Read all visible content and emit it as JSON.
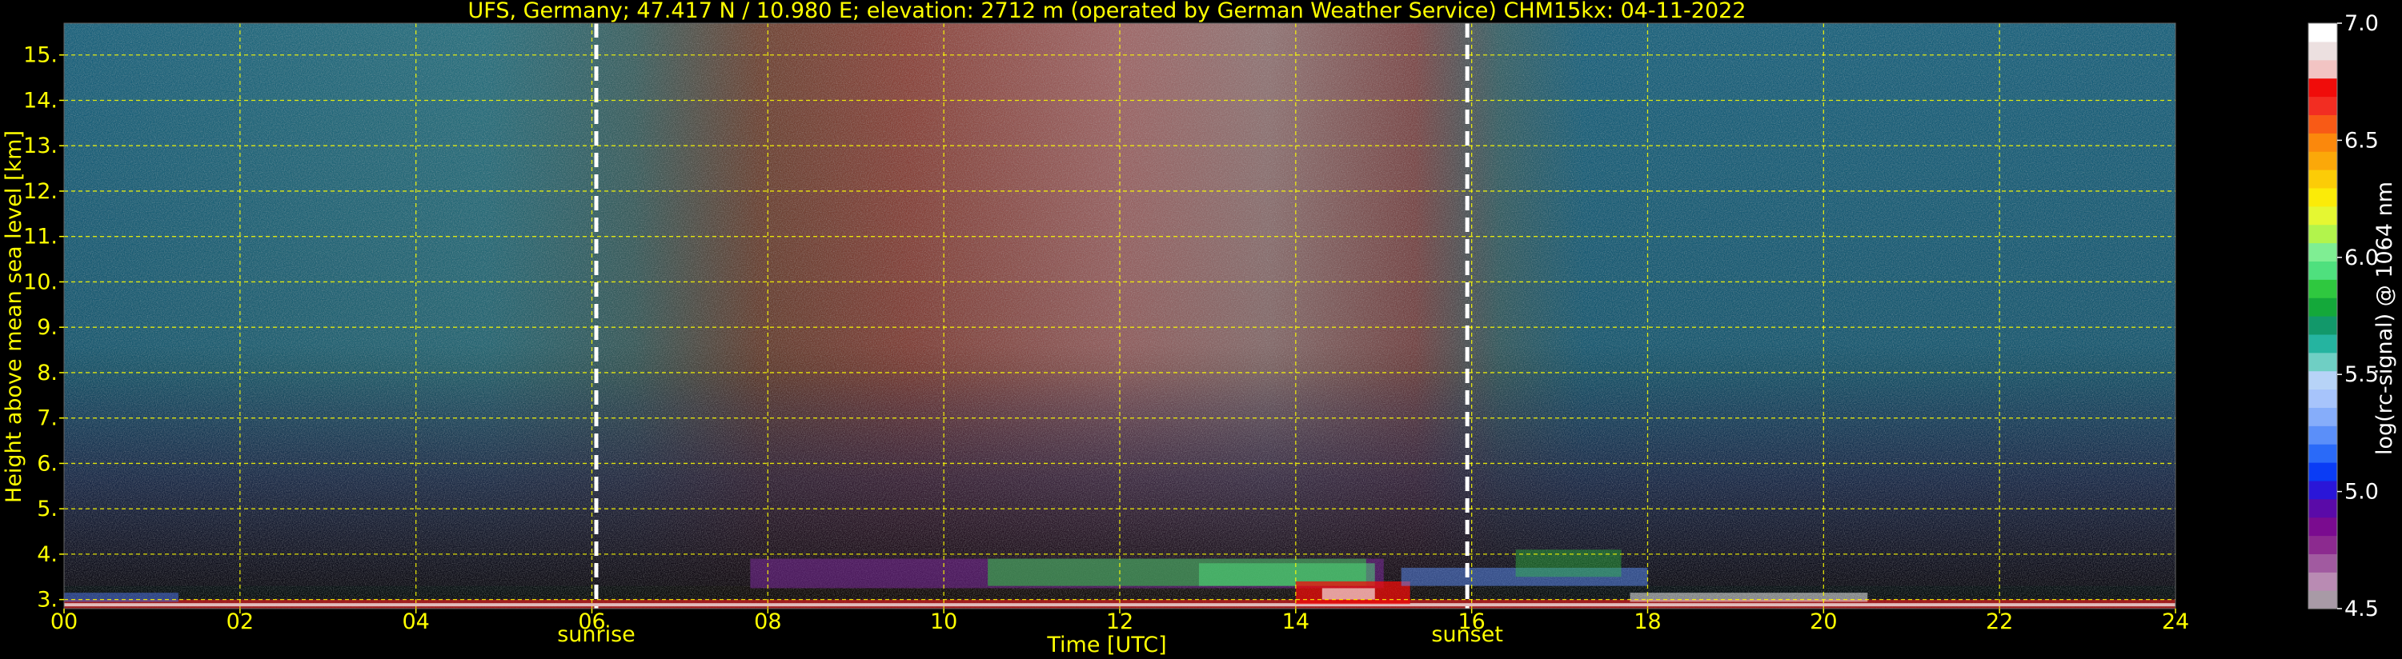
{
  "chart_data": {
    "type": "heatmap",
    "title": "UFS, Germany; 47.417 N / 10.980 E; elevation: 2712 m  (operated by German Weather Service)     CHM15kx: 04-11-2022",
    "xlabel": "Time [UTC]",
    "ylabel": "Height above mean sea level [km]",
    "xlim": [
      0,
      24
    ],
    "ylim": [
      2.8,
      15.7
    ],
    "x_ticks": [
      "00",
      "02",
      "04",
      "06",
      "08",
      "10",
      "12",
      "14",
      "16",
      "18",
      "20",
      "22",
      "24"
    ],
    "x_tick_values": [
      0,
      2,
      4,
      6,
      8,
      10,
      12,
      14,
      16,
      18,
      20,
      22,
      24
    ],
    "y_ticks": [
      "3.",
      "4.",
      "5.",
      "6.",
      "7.",
      "8.",
      "9.",
      "10.",
      "11.",
      "12.",
      "13.",
      "14.",
      "15."
    ],
    "y_tick_values": [
      3,
      4,
      5,
      6,
      7,
      8,
      9,
      10,
      11,
      12,
      13,
      14,
      15
    ],
    "grid": true,
    "annotations": [
      {
        "label": "sunrise",
        "x": 6.05
      },
      {
        "label": "sunset",
        "x": 15.95
      }
    ],
    "colorbar": {
      "label": "log(rc-signal) @ 1064 nm",
      "range": [
        4.5,
        7.0
      ],
      "ticks": [
        "4.5",
        "5.0",
        "5.5",
        "6.0",
        "6.5",
        "7.0"
      ],
      "tick_values": [
        4.5,
        5.0,
        5.5,
        6.0,
        6.5,
        7.0
      ],
      "colors": [
        "#a89aa6",
        "#b98bb3",
        "#a15aa0",
        "#8c2a8f",
        "#7a0b8f",
        "#5a0aa8",
        "#2a16d8",
        "#0a3cf5",
        "#2a6af8",
        "#5b8ff9",
        "#86adfa",
        "#a7c4fb",
        "#b7d3f7",
        "#6fcfc4",
        "#25b4a0",
        "#12986a",
        "#14a83a",
        "#2fc83f",
        "#4fe07e",
        "#7fee93",
        "#b2f44c",
        "#e5f732",
        "#fbeb08",
        "#fccc07",
        "#fba809",
        "#fb880c",
        "#f85a16",
        "#f22d22",
        "#f00c0a",
        "#f2c4c3",
        "#ece0e0",
        "#ffffff"
      ]
    },
    "text_color": "#ffff00",
    "grid_color": "#ffff00"
  }
}
